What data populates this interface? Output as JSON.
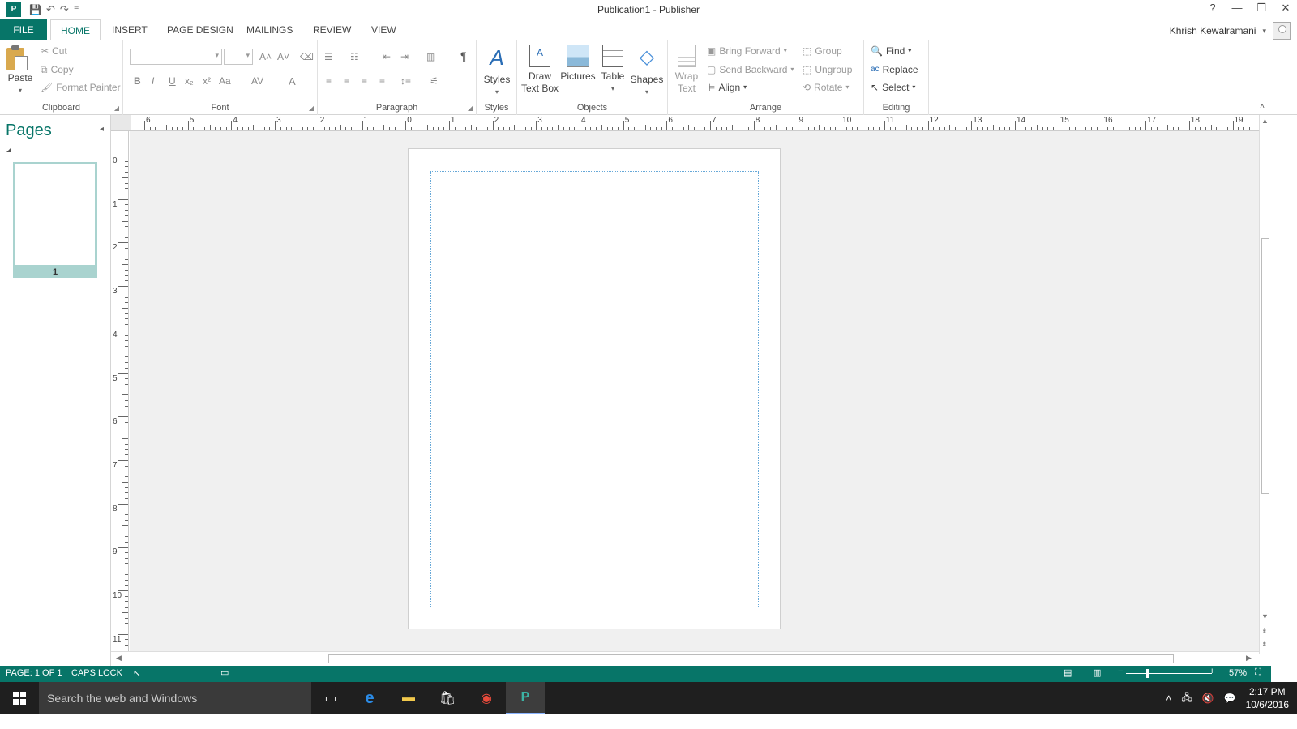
{
  "window": {
    "title": "Publication1 - Publisher",
    "app_icon": "P",
    "controls": [
      "?",
      "—",
      "❐",
      "✕"
    ]
  },
  "qat": {
    "save_icon": "💾",
    "undo_icon": "↶",
    "redo_icon": "↷",
    "customize_icon": "⁼"
  },
  "tabs": {
    "file": "FILE",
    "home": "HOME",
    "insert": "INSERT",
    "page_design": "PAGE DESIGN",
    "mailings": "MAILINGS",
    "review": "REVIEW",
    "view": "VIEW"
  },
  "user": {
    "name": "Khrish Kewalramani"
  },
  "ribbon": {
    "clipboard": {
      "label": "Clipboard",
      "paste": "Paste",
      "cut": "Cut",
      "copy": "Copy",
      "format_painter": "Format Painter"
    },
    "font": {
      "label": "Font",
      "bold": "B",
      "italic": "I",
      "underline": "U",
      "subscript": "x₂",
      "superscript": "x²",
      "change_case": "Aa",
      "spacing": "AV",
      "font_color": "A",
      "grow": "A˄",
      "shrink": "A˅"
    },
    "paragraph": {
      "label": "Paragraph",
      "pilcrow": "¶"
    },
    "styles": {
      "label": "Styles",
      "styles": "Styles"
    },
    "objects": {
      "label": "Objects",
      "draw_text_box_1": "Draw",
      "draw_text_box_2": "Text Box",
      "pictures": "Pictures",
      "table": "Table",
      "shapes": "Shapes"
    },
    "arrange": {
      "label": "Arrange",
      "wrap_text_1": "Wrap",
      "wrap_text_2": "Text",
      "bring_forward": "Bring Forward",
      "send_backward": "Send Backward",
      "align": "Align",
      "group": "Group",
      "ungroup": "Ungroup",
      "rotate": "Rotate"
    },
    "editing": {
      "label": "Editing",
      "find": "Find",
      "replace": "Replace",
      "select": "Select"
    }
  },
  "pages_pane": {
    "title": "Pages",
    "page_number": "1"
  },
  "ruler": {
    "top_numbers": [
      "6",
      "5",
      "4",
      "3",
      "2",
      "1",
      "0",
      "1",
      "2",
      "3",
      "4",
      "5",
      "6",
      "7",
      "8",
      "9",
      "10",
      "11",
      "12",
      "13",
      "14",
      "15",
      "16",
      "17",
      "18",
      "19"
    ],
    "left_numbers": [
      "0",
      "1",
      "2",
      "3",
      "4",
      "5",
      "6",
      "7",
      "8",
      "9",
      "10",
      "11"
    ]
  },
  "status": {
    "page": "PAGE: 1 OF 1",
    "caps_lock": "CAPS LOCK",
    "zoom": "57%"
  },
  "taskbar": {
    "search_placeholder": "Search the web and Windows",
    "time": "2:17 PM",
    "date": "10/6/2016"
  }
}
